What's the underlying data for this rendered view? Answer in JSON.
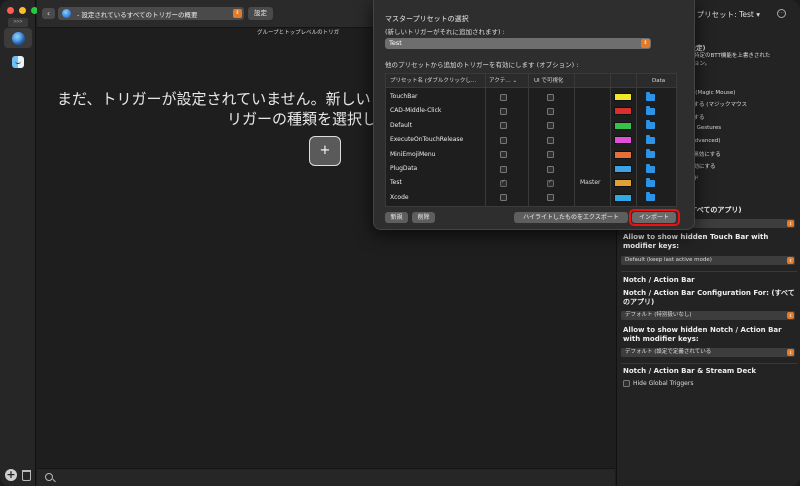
{
  "sidebar": {
    "collapse_label": ">>>",
    "traffic": [
      "#fe5f57",
      "#febc2e",
      "#28c840"
    ]
  },
  "toolbar": {
    "back_label": "‹",
    "scope_label": "- 設定されているすべてのトリガーの概要",
    "settings_label": "設定"
  },
  "main": {
    "group_header": "グループとトップレベルのトリガ",
    "empty_line1": "まだ、トリガーが設定されていません。新しい",
    "empty_line2": "リガーの種類を選択し",
    "add_label": "+"
  },
  "right_panel": {
    "preset_title": "プリセット: Test ▾",
    "more_label": "···",
    "partial_lines": [
      "の設定)",
      "リの特定のBTT機能を上書きされた",
      "プション。"
    ],
    "options": [
      "にする (Magic Mouse)",
      "無効にする (マジックマウス",
      "無効にする",
      "Mouse Gestures",
      "tion (advanced)",
      "ジャを無効にする",
      "全に無効にする",
      "換モード"
    ],
    "scope_partial": "(すべてのアプリ)",
    "scope_partial_select": "リ)",
    "touchbar_hidden_label": "Allow to show hidden Touch Bar with modifier keys:",
    "touchbar_hidden_value": "Default (keep last active mode)",
    "notch_section": "Notch / Action Bar",
    "notch_config_label": "Notch / Action Bar Configuration For: (すべてのアプリ)",
    "notch_config_value": "デフォルト (特別扱いなし)",
    "notch_hidden_label": "Allow to show hidden Notch / Action Bar with modifier keys:",
    "notch_hidden_value": "デフォルト (設定で定義されている",
    "stream_section": "Notch / Action Bar & Stream Deck",
    "hide_global_label": "Hide Global Triggers"
  },
  "dialog": {
    "title": "マスタープリセットの選択",
    "subtitle": "(新しいトリガーがそれに追加されます) :",
    "selected_preset": "Test",
    "enable_label": "他のプリセットから追加のトリガーを有効にします (オプション) :",
    "columns": [
      "プリセット名 (ダブルクリックし…",
      "アクテ… ⌄",
      "UI で可視化",
      "",
      "Data"
    ],
    "rows": [
      {
        "name": "TouchBar",
        "active": false,
        "visible": false,
        "master": "",
        "color": "#f0e62a"
      },
      {
        "name": "CAD-Middle-Click",
        "active": false,
        "visible": false,
        "master": "",
        "color": "#d8302c"
      },
      {
        "name": "Default",
        "active": false,
        "visible": false,
        "master": "",
        "color": "#35c24a"
      },
      {
        "name": "ExecuteOnTouchRelease",
        "active": false,
        "visible": false,
        "master": "",
        "color": "#e04fd8"
      },
      {
        "name": "MiniEmojiMenu",
        "active": false,
        "visible": false,
        "master": "",
        "color": "#e2703a"
      },
      {
        "name": "PlugData",
        "active": false,
        "visible": false,
        "master": "",
        "color": "#3fa2e6"
      },
      {
        "name": "Test",
        "active": true,
        "visible": true,
        "master": "Master",
        "color": "#e0a035"
      },
      {
        "name": "Xcode",
        "active": false,
        "visible": false,
        "master": "",
        "color": "#2fa8e8"
      }
    ],
    "new_label": "新規",
    "delete_label": "削除",
    "export_label": "ハイライトしたものをエクスポート",
    "import_label": "インポート"
  }
}
